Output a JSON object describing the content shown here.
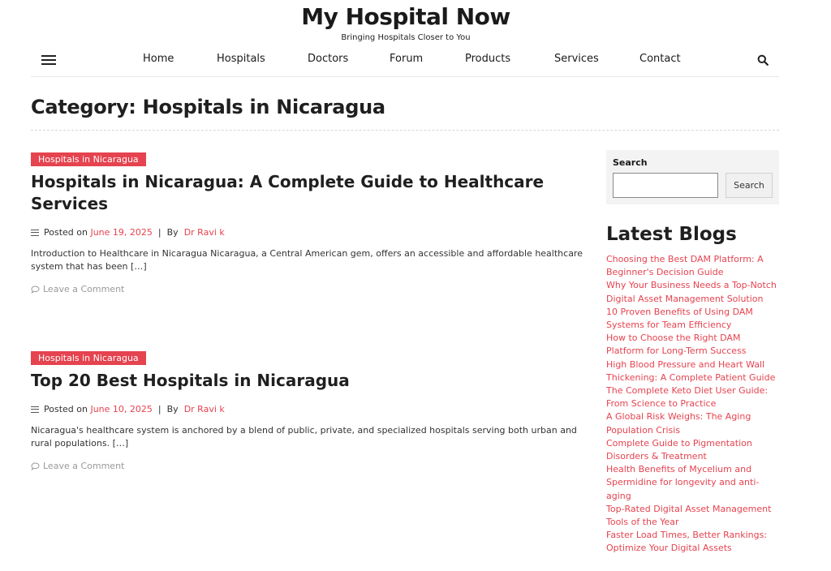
{
  "site": {
    "title": "My Hospital Now",
    "tagline": "Bringing Hospitals Closer to You"
  },
  "nav": {
    "items": [
      "Home",
      "Hospitals",
      "Doctors",
      "Forum",
      "Products",
      "Services",
      "Contact"
    ],
    "menu_icon": "hamburger-icon",
    "search_icon": "search-icon"
  },
  "page_title": "Category: Hospitals in Nicaragua",
  "posts": [
    {
      "category": "Hospitals in Nicaragua",
      "title": "Hospitals in Nicaragua: A Complete Guide to Healthcare Services",
      "posted_label": "Posted on",
      "date": "June 19, 2025",
      "separator": "|",
      "by_label": "By",
      "author": "Dr Ravi k",
      "excerpt": "Introduction to Healthcare in Nicaragua Nicaragua, a Central American gem, offers an accessible and affordable healthcare system that has been […]",
      "comment_label": "Leave a Comment"
    },
    {
      "category": "Hospitals in Nicaragua",
      "title": "Top 20 Best Hospitals in Nicaragua",
      "posted_label": "Posted on",
      "date": "June 10, 2025",
      "separator": "|",
      "by_label": "By",
      "author": "Dr Ravi k",
      "excerpt": "Nicaragua's healthcare system is anchored by a blend of public, private, and specialized hospitals serving both urban and rural populations. […]",
      "comment_label": "Leave a Comment"
    }
  ],
  "sidebar": {
    "search_label": "Search",
    "search_placeholder": "",
    "search_button": "Search",
    "latest_heading": "Latest Blogs",
    "blogs": [
      "Choosing the Best DAM Platform: A Beginner's Decision Guide",
      "Why Your Business Needs a Top-Notch Digital Asset Management Solution",
      "10 Proven Benefits of Using DAM Systems for Team Efficiency",
      "How to Choose the Right DAM Platform for Long-Term Success",
      "High Blood Pressure and Heart Wall Thickening: A Complete Patient Guide",
      "The Complete Keto Diet User Guide: From Science to Practice",
      "A Global Risk Weighs: The Aging Population Crisis",
      "Complete Guide to Pigmentation Disorders & Treatment",
      "Health Benefits of Mycelium and Spermidine for longevity and anti-aging",
      "Top-Rated Digital Asset Management Tools of the Year",
      "Faster Load Times, Better Rankings: Optimize Your Digital Assets"
    ]
  },
  "colors": {
    "accent": "#e5434f",
    "text": "#1f1f1f",
    "muted": "#999999"
  }
}
